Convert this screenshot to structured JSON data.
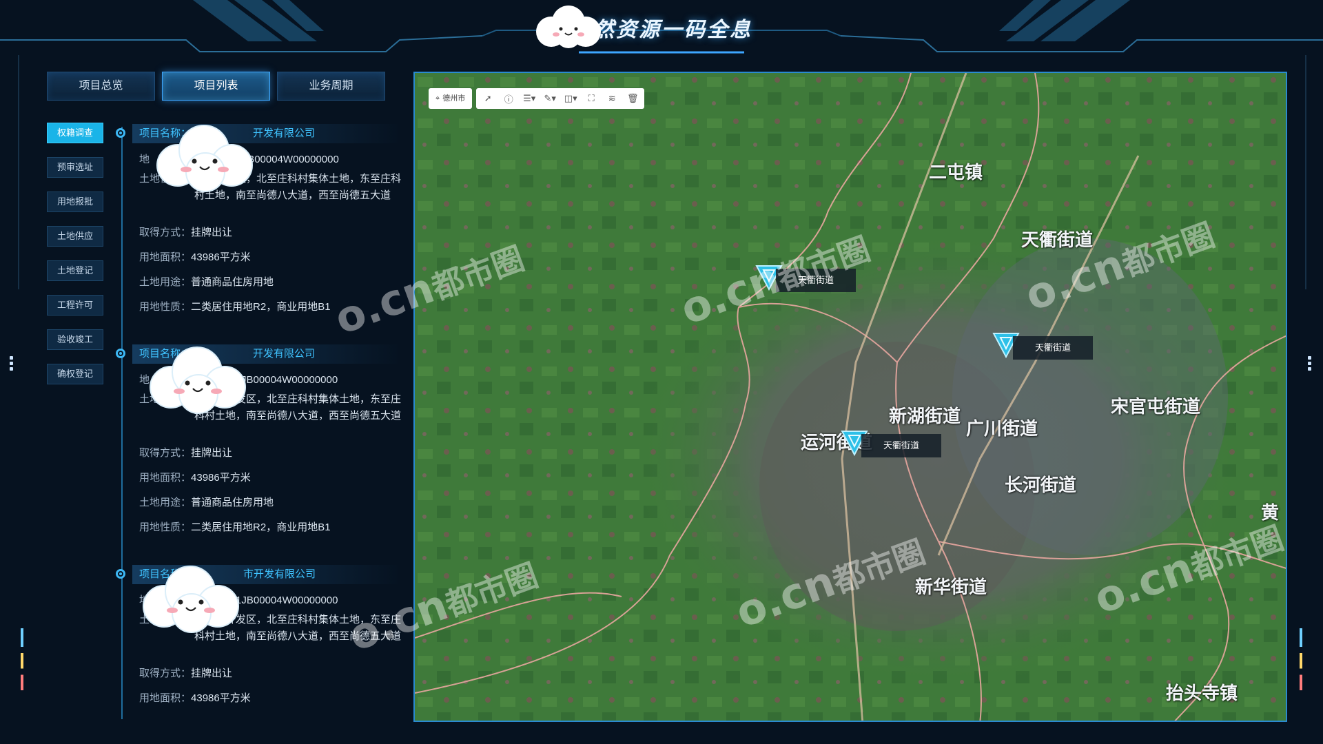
{
  "header": {
    "title": "自然资源一码全息"
  },
  "tabs": [
    {
      "label": "项目总览",
      "active": false
    },
    {
      "label": "项目列表",
      "active": true
    },
    {
      "label": "业务周期",
      "active": false
    }
  ],
  "phases": [
    {
      "label": "权籍调查",
      "active": true
    },
    {
      "label": "预审选址",
      "active": false
    },
    {
      "label": "用地报批",
      "active": false
    },
    {
      "label": "土地供应",
      "active": false
    },
    {
      "label": "土地登记",
      "active": false
    },
    {
      "label": "工程许可",
      "active": false
    },
    {
      "label": "验收竣工",
      "active": false
    },
    {
      "label": "确权登记",
      "active": false
    }
  ],
  "projects": [
    {
      "name_visible": "项目名称：",
      "name_suffix": "开发有限公司",
      "code_visible": "61JB00004W00000000",
      "location_label": "土地位置：",
      "location_value": "技术开发区，北至庄科村集体土地，东至庄科村土地，南至尚德八大道，西至尚德五大道",
      "rows": [
        {
          "k": "取得方式：",
          "v": "挂牌出让"
        },
        {
          "k": "用地面积：",
          "v": "43986平方米"
        },
        {
          "k": "土地用途：",
          "v": "普通商品住房用地"
        },
        {
          "k": "用地性质：",
          "v": "二类居住用地R2，商业用地B1"
        }
      ]
    },
    {
      "name_visible": "项目名称：",
      "name_suffix": "开发有限公司",
      "code_visible": "061JB00004W00000000",
      "location_label": "土地位置：",
      "location_value": "济技术开发区，北至庄科村集体土地，东至庄科村土地，南至尚德八大道，西至尚德五大道",
      "rows": [
        {
          "k": "取得方式：",
          "v": "挂牌出让"
        },
        {
          "k": "用地面积：",
          "v": "43986平方米"
        },
        {
          "k": "土地用途：",
          "v": "普通商品住房用地"
        },
        {
          "k": "用地性质：",
          "v": "二类居住用地R2，商业用地B1"
        }
      ]
    },
    {
      "name_visible": "项目名称：",
      "name_suffix": "市开发有限公司",
      "code_visible": "6061JB00004W00000000",
      "location_label": "土地位置：",
      "location_value": "济技术开发区，北至庄科村集体土地，东至庄科村土地，南至尚德八大道，西至尚德五大道",
      "rows": [
        {
          "k": "取得方式：",
          "v": "挂牌出让"
        },
        {
          "k": "用地面积：",
          "v": "43986平方米"
        }
      ]
    }
  ],
  "map": {
    "city": "德州市",
    "tools": [
      "arrow-icon",
      "info-icon",
      "list-icon",
      "draw-icon",
      "split-icon",
      "frame-icon",
      "layers-icon",
      "trash-icon"
    ],
    "places": [
      "二屯镇",
      "天衢街道",
      "新湖街道",
      "广川街道",
      "宋官屯街道",
      "运河街道",
      "长河街道",
      "新华街道",
      "抬头寺镇",
      "黄"
    ],
    "markers": [
      {
        "label": "天衢街道"
      },
      {
        "label": "天衢街道"
      },
      {
        "label": "天衢街道"
      }
    ]
  },
  "watermark": {
    "brand": "o.cn",
    "text": "都市圈"
  },
  "colors": {
    "accent": "#3fc3ff",
    "active_phase": "#1ab4e8",
    "map_border": "#2a8ad0",
    "background": "#061220"
  }
}
